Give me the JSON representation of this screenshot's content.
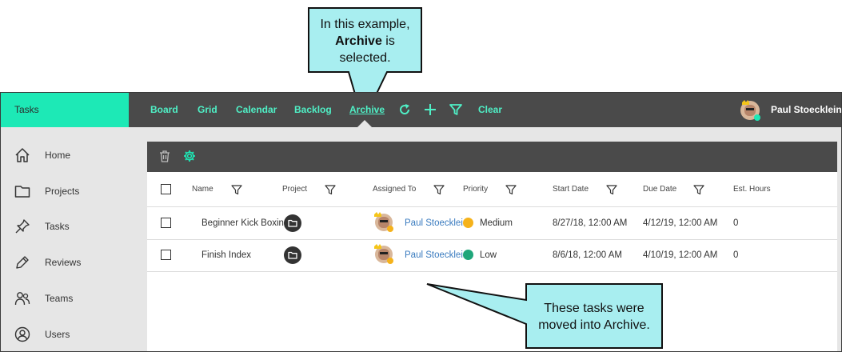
{
  "callout_top": {
    "line1": "In this example,",
    "line2_bold": "Archive",
    "line2_rest": " is",
    "line3": "selected."
  },
  "callout_bottom": {
    "line1": "These tasks were",
    "line2": "moved into Archive."
  },
  "app": {
    "brand": "Tasks",
    "nav": [
      "Board",
      "Grid",
      "Calendar",
      "Backlog",
      "Archive"
    ],
    "active_nav": "Archive",
    "clear_label": "Clear",
    "user_name": "Paul Stoecklein",
    "accent_color": "#1de9b6"
  },
  "sidebar": {
    "items": [
      {
        "label": "Home",
        "icon": "home-icon"
      },
      {
        "label": "Projects",
        "icon": "folder-icon"
      },
      {
        "label": "Tasks",
        "icon": "pin-icon"
      },
      {
        "label": "Reviews",
        "icon": "pen-icon"
      },
      {
        "label": "Teams",
        "icon": "people-icon"
      },
      {
        "label": "Users",
        "icon": "user-circle-icon"
      }
    ]
  },
  "table": {
    "columns": [
      "Name",
      "Project",
      "Assigned To",
      "Priority",
      "Start Date",
      "Due Date",
      "Est. Hours"
    ],
    "rows": [
      {
        "name": "Beginner Kick Boxing",
        "assigned_to": "Paul Stoecklein",
        "priority": "Medium",
        "priority_color": "#f5b21b",
        "start_date": "8/27/18, 12:00 AM",
        "due_date": "4/12/19, 12:00 AM",
        "est_hours": "0"
      },
      {
        "name": "Finish Index",
        "assigned_to": "Paul Stoecklein",
        "priority": "Low",
        "priority_color": "#1fa67a",
        "start_date": "8/6/18, 12:00 AM",
        "due_date": "4/10/19, 12:00 AM",
        "est_hours": "0"
      }
    ]
  }
}
